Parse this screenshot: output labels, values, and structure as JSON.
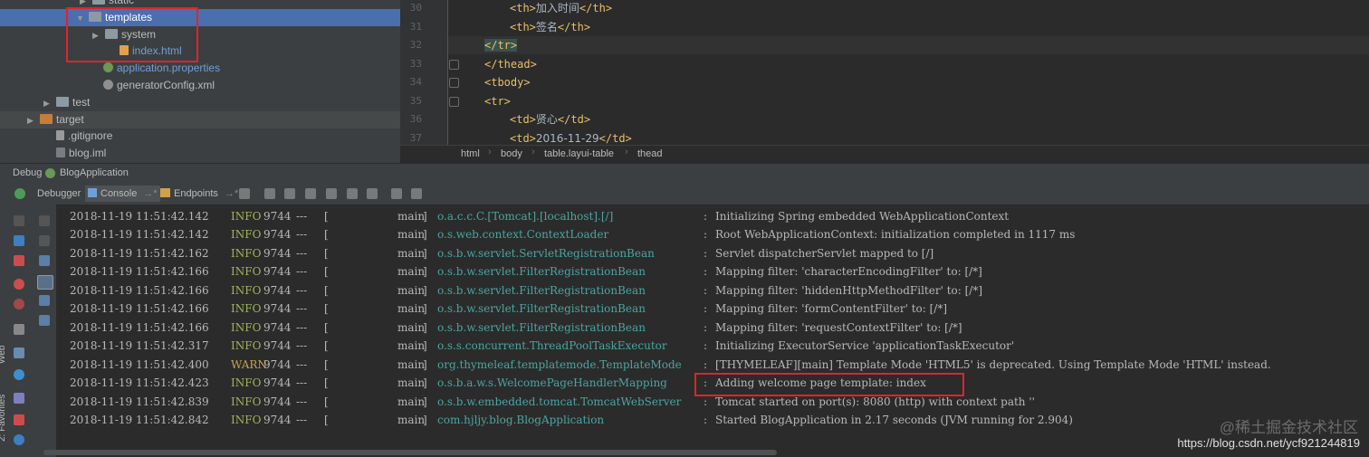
{
  "tree": {
    "items": [
      {
        "label": "static",
        "indent": 88,
        "arrow": "▶",
        "icon": "folder"
      },
      {
        "label": "templates",
        "indent": 84,
        "arrow": "▼",
        "icon": "folder",
        "selected": true
      },
      {
        "label": "system",
        "indent": 102,
        "arrow": "▶",
        "icon": "folder"
      },
      {
        "label": "index.html",
        "indent": 118,
        "arrow": "",
        "icon": "html",
        "blue": true
      },
      {
        "label": "application.properties",
        "indent": 100,
        "arrow": "",
        "icon": "leaf",
        "blue": true
      },
      {
        "label": "generatorConfig.xml",
        "indent": 100,
        "arrow": "",
        "icon": "gear"
      },
      {
        "label": "test",
        "indent": 48,
        "arrow": "▶",
        "icon": "folder"
      },
      {
        "label": "target",
        "indent": 30,
        "arrow": "▶",
        "icon": "folder-o",
        "dim": true
      },
      {
        "label": ".gitignore",
        "indent": 48,
        "arrow": "",
        "icon": "file"
      },
      {
        "label": "blog.iml",
        "indent": 48,
        "arrow": "",
        "icon": "iml"
      }
    ]
  },
  "editor": {
    "lines": [
      {
        "num": "30",
        "indent": 4,
        "open": "<th>",
        "text": "加入时间",
        "close": "</th>"
      },
      {
        "num": "31",
        "indent": 4,
        "open": "<th>",
        "text": "签名",
        "close": "</th>"
      },
      {
        "num": "32",
        "indent": 0,
        "open": "</tr>",
        "text": "",
        "close": "",
        "highlight": true
      },
      {
        "num": "33",
        "indent": 0,
        "open": "</thead>",
        "text": "",
        "close": ""
      },
      {
        "num": "34",
        "indent": 0,
        "open": "<tbody>",
        "text": "",
        "close": ""
      },
      {
        "num": "35",
        "indent": 0,
        "open": "<tr>",
        "text": "",
        "close": ""
      },
      {
        "num": "36",
        "indent": 4,
        "open": "<td>",
        "text": "贤心",
        "close": "</td>"
      },
      {
        "num": "37",
        "indent": 4,
        "open": "<td>",
        "text": "2016-11-29",
        "close": "</td>"
      }
    ],
    "breadcrumb": [
      "html",
      "body",
      "table.layui-table",
      "thead"
    ]
  },
  "debug": {
    "label": "Debug",
    "config": "BlogApplication"
  },
  "toolbar": {
    "debugger": "Debugger",
    "console": "Console",
    "console_suffix": "→*",
    "endpoints": "Endpoints",
    "endpoints_suffix": "→*"
  },
  "side": {
    "web": "Web",
    "favorites": "2: Favorites"
  },
  "console": {
    "rows": [
      {
        "ts": "2018-11-19 11:51:42.142",
        "level": "INFO",
        "pid": "9744",
        "thread": "main",
        "logger": "o.a.c.c.C.[Tomcat].[localhost].[/]",
        "msg": "Initializing Spring embedded WebApplicationContext"
      },
      {
        "ts": "2018-11-19 11:51:42.142",
        "level": "INFO",
        "pid": "9744",
        "thread": "main",
        "logger": "o.s.web.context.ContextLoader",
        "msg": "Root WebApplicationContext: initialization completed in 1117 ms"
      },
      {
        "ts": "2018-11-19 11:51:42.162",
        "level": "INFO",
        "pid": "9744",
        "thread": "main",
        "logger": "o.s.b.w.servlet.ServletRegistrationBean",
        "msg": "Servlet dispatcherServlet mapped to [/]"
      },
      {
        "ts": "2018-11-19 11:51:42.166",
        "level": "INFO",
        "pid": "9744",
        "thread": "main",
        "logger": "o.s.b.w.servlet.FilterRegistrationBean",
        "msg": "Mapping filter: 'characterEncodingFilter' to: [/*]"
      },
      {
        "ts": "2018-11-19 11:51:42.166",
        "level": "INFO",
        "pid": "9744",
        "thread": "main",
        "logger": "o.s.b.w.servlet.FilterRegistrationBean",
        "msg": "Mapping filter: 'hiddenHttpMethodFilter' to: [/*]"
      },
      {
        "ts": "2018-11-19 11:51:42.166",
        "level": "INFO",
        "pid": "9744",
        "thread": "main",
        "logger": "o.s.b.w.servlet.FilterRegistrationBean",
        "msg": "Mapping filter: 'formContentFilter' to: [/*]"
      },
      {
        "ts": "2018-11-19 11:51:42.166",
        "level": "INFO",
        "pid": "9744",
        "thread": "main",
        "logger": "o.s.b.w.servlet.FilterRegistrationBean",
        "msg": "Mapping filter: 'requestContextFilter' to: [/*]"
      },
      {
        "ts": "2018-11-19 11:51:42.317",
        "level": "INFO",
        "pid": "9744",
        "thread": "main",
        "logger": "o.s.s.concurrent.ThreadPoolTaskExecutor",
        "msg": "Initializing ExecutorService 'applicationTaskExecutor'"
      },
      {
        "ts": "2018-11-19 11:51:42.400",
        "level": "WARN",
        "pid": "9744",
        "thread": "main",
        "logger": "org.thymeleaf.templatemode.TemplateMode",
        "msg": "[THYMELEAF][main] Template Mode 'HTML5' is deprecated. Using Template Mode 'HTML' instead."
      },
      {
        "ts": "2018-11-19 11:51:42.423",
        "level": "INFO",
        "pid": "9744",
        "thread": "main",
        "logger": "o.s.b.a.w.s.WelcomePageHandlerMapping",
        "msg": "Adding welcome page template: index"
      },
      {
        "ts": "2018-11-19 11:51:42.839",
        "level": "INFO",
        "pid": "9744",
        "thread": "main",
        "logger": "o.s.b.w.embedded.tomcat.TomcatWebServer",
        "msg": "Tomcat started on port(s): 8080 (http) with context path ''"
      },
      {
        "ts": "2018-11-19 11:51:42.842",
        "level": "INFO",
        "pid": "9744",
        "thread": "main",
        "logger": "com.hjljy.blog.BlogApplication",
        "msg": "Started BlogApplication in 2.17 seconds (JVM running for 2.904)"
      }
    ]
  },
  "watermark": {
    "top": "@稀土掘金技术社区",
    "bottom": "https://blog.csdn.net/ycf921244819"
  },
  "colors": {
    "highlight_box": "#e0232b",
    "selection": "#4b6eaf",
    "info": "#a0b45b",
    "warn": "#c9a34b",
    "logger": "#4aa5a0"
  }
}
